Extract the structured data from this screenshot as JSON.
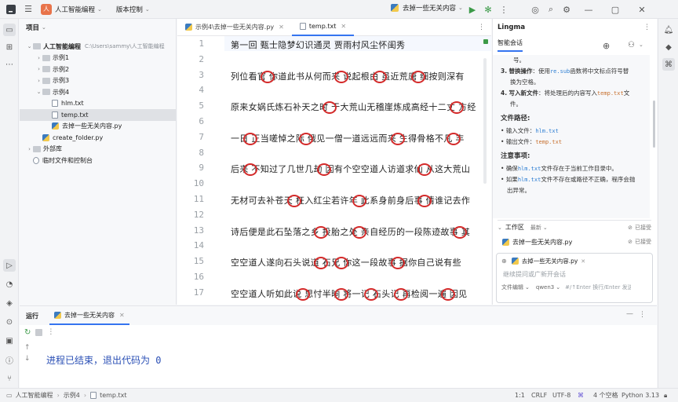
{
  "topbar": {
    "project_badge": "人",
    "project_name": "人工智能编程",
    "vcs": "版本控制",
    "run_config": "去掉一些无关内容"
  },
  "project_panel": {
    "title": "项目",
    "items": [
      {
        "label": "人工智能编程",
        "path": "C:\\Users\\sammy\\人工智能编程",
        "type": "folder",
        "arrow": "⌄",
        "indent": 0
      },
      {
        "label": "示例1",
        "type": "folder",
        "arrow": "›",
        "indent": 1
      },
      {
        "label": "示例2",
        "type": "folder",
        "arrow": "›",
        "indent": 1
      },
      {
        "label": "示例3",
        "type": "folder",
        "arrow": "›",
        "indent": 1
      },
      {
        "label": "示例4",
        "type": "folder",
        "arrow": "⌄",
        "indent": 1
      },
      {
        "label": "hlm.txt",
        "type": "txt",
        "arrow": "",
        "indent": 2
      },
      {
        "label": "temp.txt",
        "type": "txt",
        "arrow": "",
        "indent": 2,
        "selected": true
      },
      {
        "label": "去掉一些无关内容.py",
        "type": "py",
        "arrow": "",
        "indent": 2
      },
      {
        "label": "create_folder.py",
        "type": "py",
        "arrow": "",
        "indent": 1
      },
      {
        "label": "外部库",
        "type": "lib",
        "arrow": "›",
        "indent": 0
      },
      {
        "label": "临时文件和控制台",
        "type": "scratch",
        "arrow": "",
        "indent": 0
      }
    ]
  },
  "editor": {
    "tabs": [
      {
        "label": "示例4\\去掉一些无关内容.py",
        "type": "py"
      },
      {
        "label": "temp.txt",
        "type": "txt",
        "active": true
      }
    ],
    "lines": [
      {
        "num": "1",
        "text": "第一回    甄士隐梦幻识通灵  贾雨村风尘怀闺秀"
      },
      {
        "num": "2",
        "text": ""
      },
      {
        "num": "3",
        "text": "列位看官 你道此书从何而来 说起根由 虽近荒唐 细按则深有"
      },
      {
        "num": "4",
        "text": ""
      },
      {
        "num": "5",
        "text": "原来女娲氏炼石补天之时 于大荒山无稽崖炼成高经十二丈 方经"
      },
      {
        "num": "6",
        "text": ""
      },
      {
        "num": "7",
        "text": "一日 正当嗟悼之际 俄见一僧一道远远而来 生得骨格不凡 丰"
      },
      {
        "num": "8",
        "text": ""
      },
      {
        "num": "9",
        "text": "后来 不知过了几世几劫 因有个空空道人访道求仙 从这大荒山"
      },
      {
        "num": "10",
        "text": ""
      },
      {
        "num": "11",
        "text": "无材可去补苍天 枉入红尘若许年 此系身前身后事 倩谁记去作"
      },
      {
        "num": "12",
        "text": ""
      },
      {
        "num": "13",
        "text": "诗后便是此石坠落之乡 投胎之处 亲自经历的一段陈迹故事 其"
      },
      {
        "num": "14",
        "text": ""
      },
      {
        "num": "15",
        "text": "空空道人遂向石头说道 石兄 你这一段故事 据你自己说有些"
      },
      {
        "num": "16",
        "text": ""
      },
      {
        "num": "17",
        "text": "空空道人听如此说 思忖半晌 将一记 石头记 再检阅一遍 因见"
      }
    ]
  },
  "chat": {
    "title": "Lingma",
    "tab": "智能会话",
    "step_tail": "号。",
    "step3_num": "3.",
    "step3_bold": "替换操作",
    "step3_text_a": "：使用",
    "step3_code": "re.sub",
    "step3_text_b": "函数将中文标点符号替",
    "step3_text_c": "换为空格。",
    "step4_num": "4.",
    "step4_bold": "写入新文件",
    "step4_text_a": "：将处理后的内容写入",
    "step4_code": "temp.txt",
    "step4_text_b": "文",
    "step4_text_c": "件。",
    "paths_heading": "文件路径:",
    "input_label": "输入文件：",
    "input_file": "hlm.txt",
    "output_label": "输出文件：",
    "output_file": "temp.txt",
    "notes_heading": "注意事项:",
    "note1_a": "确保",
    "note1_code": "hlm.txt",
    "note1_b": "文件存在于当前工作目录中。",
    "note2_a": "如果",
    "note2_code": "hlm.txt",
    "note2_b": "文件不存在或路径不正确，程序会抛",
    "note2_c": "出异常。",
    "workspace_label": "工作区",
    "workspace_latest": "最新",
    "accepted_1": "已接受",
    "ws_file": "去掉一些无关内容.py",
    "accepted_2": "已接受",
    "attached_file": "去掉一些无关内容.py",
    "input_placeholder": "继续提问或广新开会话",
    "mode": "文件编辑",
    "model": "qwen3",
    "hint": "#/↑Enter 换行/Enter 发送"
  },
  "run": {
    "label": "运行",
    "tab": "去掉一些无关内容",
    "output": "进程已结束，退出代码为 0"
  },
  "status": {
    "crumb1": "人工智能编程",
    "crumb2": "示例4",
    "crumb3": "temp.txt",
    "position": "1:1",
    "line_sep": "CRLF",
    "encoding": "UTF-8",
    "indent": "4 个空格",
    "interpreter": "Python 3.13"
  }
}
